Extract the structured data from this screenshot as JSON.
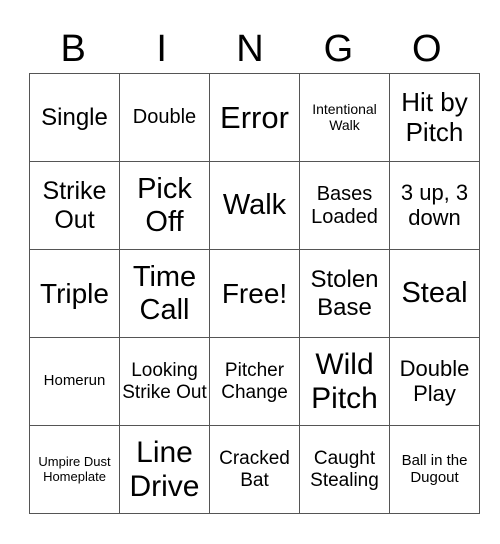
{
  "header": [
    "B",
    "I",
    "N",
    "G",
    "O"
  ],
  "cells": [
    [
      "Single",
      "Double",
      "Error",
      "Intentional Walk",
      "Hit by Pitch"
    ],
    [
      "Strike Out",
      "Pick Off",
      "Walk",
      "Bases Loaded",
      "3 up, 3 down"
    ],
    [
      "Triple",
      "Time Call",
      "Free!",
      "Stolen Base",
      "Steal"
    ],
    [
      "Homerun",
      "Looking Strike Out",
      "Pitcher Change",
      "Wild Pitch",
      "Double Play"
    ],
    [
      "Umpire Dust Homeplate",
      "Line Drive",
      "Cracked Bat",
      "Caught Stealing",
      "Ball in the Dugout"
    ]
  ]
}
